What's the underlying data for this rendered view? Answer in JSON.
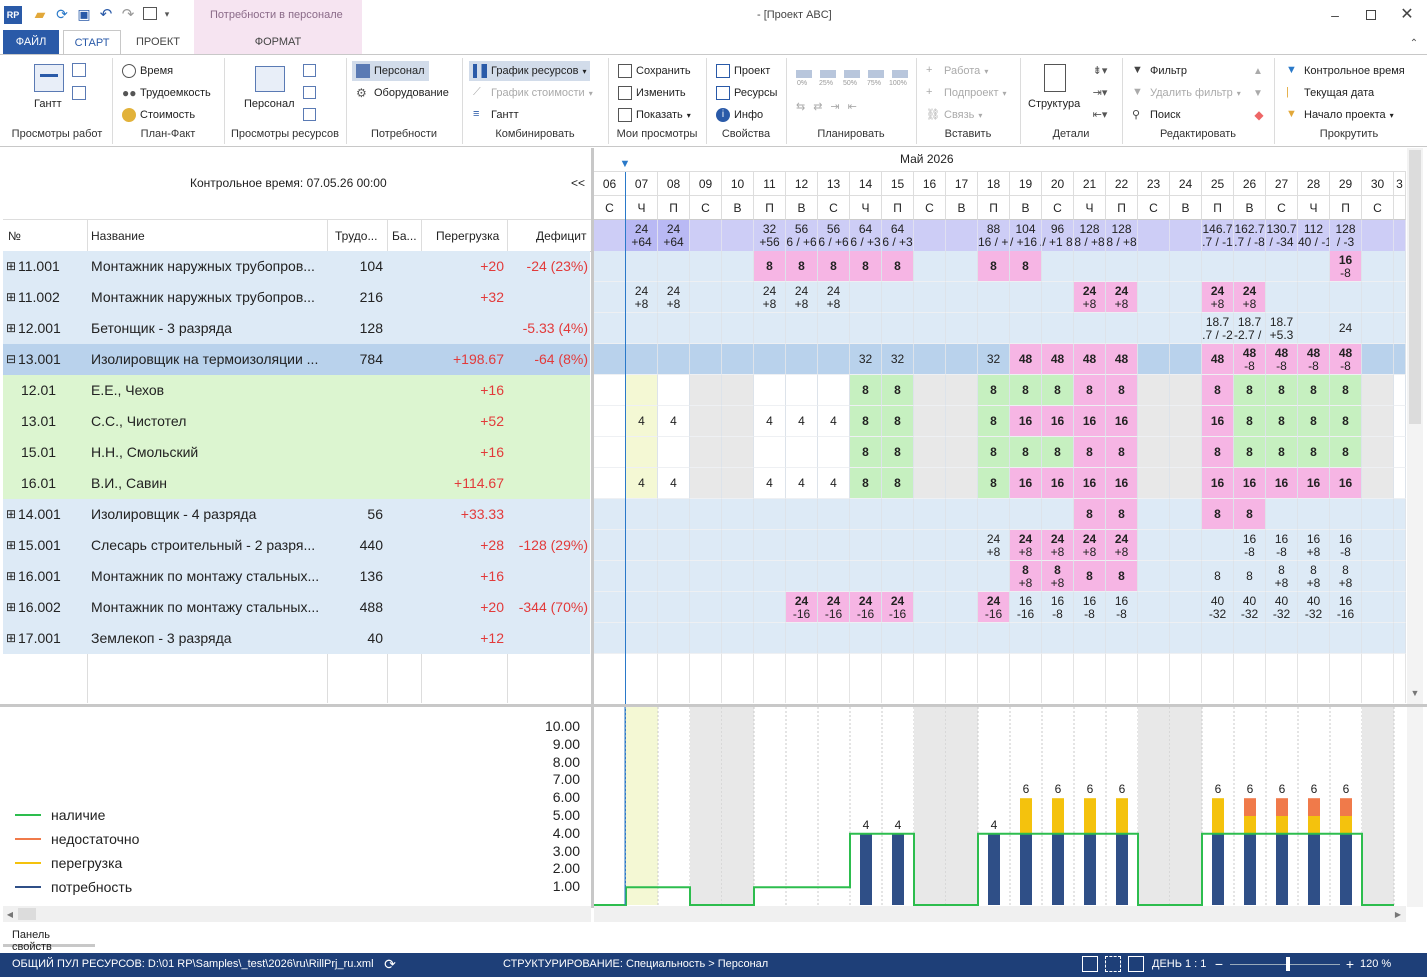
{
  "window": {
    "title": "- [Проект ABC]",
    "context_tab": "Потребности в персонале"
  },
  "menu": {
    "file": "ФАЙЛ",
    "tabs": [
      "СТАРТ",
      "ПРОЕКТ",
      "ФОРМАТ"
    ]
  },
  "ribbon": {
    "groups": [
      "Просмотры работ",
      "План-Факт",
      "Просмотры ресурсов",
      "Потребности",
      "Комбинировать",
      "Мои просмотры",
      "Свойства",
      "Планировать",
      "Вставить",
      "Детали",
      "Редактировать",
      "Прокрутить"
    ],
    "gantt": "Гантт",
    "plan_fact": [
      "Время",
      "Трудоемкость",
      "Стоимость"
    ],
    "personnel_view": "Персонал",
    "needs": [
      "Персонал",
      "Оборудование"
    ],
    "combine": [
      "График ресурсов",
      "График стоимости",
      "Гантт"
    ],
    "my_views": [
      "Сохранить",
      "Изменить",
      "Показать"
    ],
    "properties": [
      "Проект",
      "Ресурсы",
      "Инфо"
    ],
    "plan_pct": [
      "0%",
      "25%",
      "50%",
      "75%",
      "100%"
    ],
    "insert": [
      "Работа",
      "Подпроект",
      "Связь"
    ],
    "details": "Структура",
    "edit": [
      "Фильтр",
      "Удалить фильтр",
      "Поиск"
    ],
    "scroll": [
      "Контрольное время",
      "Текущая дата",
      "Начало проекта"
    ]
  },
  "left": {
    "control_time": "Контрольное время: 07.05.26 00:00",
    "collapse": "<<",
    "headers": [
      "№",
      "Название",
      "Трудо...",
      "Ба...",
      "Перегрузка",
      "Дефицит"
    ],
    "rows": [
      {
        "exp": "⊞",
        "num": "11.001",
        "name": "Монтажник наружных трубопров...",
        "work": "104",
        "over": "+20",
        "def": "-24 (23%)",
        "kind": "group"
      },
      {
        "exp": "⊞",
        "num": "11.002",
        "name": "Монтажник наружных трубопров...",
        "work": "216",
        "over": "+32",
        "def": "",
        "kind": "group"
      },
      {
        "exp": "⊞",
        "num": "12.001",
        "name": "Бетонщик - 3 разряда",
        "work": "128",
        "over": "",
        "def": "-5.33 (4%)",
        "kind": "group"
      },
      {
        "exp": "⊟",
        "num": "13.001",
        "name": "Изолировщик на термоизоляции ...",
        "work": "784",
        "over": "+198.67",
        "def": "-64 (8%)",
        "kind": "selected"
      },
      {
        "exp": "",
        "num": "12.01",
        "name": "Е.Е., Чехов",
        "work": "",
        "over": "+16",
        "def": "",
        "kind": "person"
      },
      {
        "exp": "",
        "num": "13.01",
        "name": "С.С., Чистотел",
        "work": "",
        "over": "+52",
        "def": "",
        "kind": "person"
      },
      {
        "exp": "",
        "num": "15.01",
        "name": "Н.Н., Смольский",
        "work": "",
        "over": "+16",
        "def": "",
        "kind": "person"
      },
      {
        "exp": "",
        "num": "16.01",
        "name": "В.И., Савин",
        "work": "",
        "over": "+114.67",
        "def": "",
        "kind": "person"
      },
      {
        "exp": "⊞",
        "num": "14.001",
        "name": "Изолировщик - 4 разряда",
        "work": "56",
        "over": "+33.33",
        "def": "",
        "kind": "group"
      },
      {
        "exp": "⊞",
        "num": "15.001",
        "name": "Слесарь строительный - 2 разря...",
        "work": "440",
        "over": "+28",
        "def": "-128 (29%)",
        "kind": "group"
      },
      {
        "exp": "⊞",
        "num": "16.001",
        "name": "Монтажник по монтажу стальных...",
        "work": "136",
        "over": "+16",
        "def": "",
        "kind": "group"
      },
      {
        "exp": "⊞",
        "num": "16.002",
        "name": "Монтажник по монтажу стальных...",
        "work": "488",
        "over": "+20",
        "def": "-344 (70%)",
        "kind": "group"
      },
      {
        "exp": "⊞",
        "num": "17.001",
        "name": "Землекоп - 3 разряда",
        "work": "40",
        "over": "+12",
        "def": "",
        "kind": "group"
      }
    ]
  },
  "timeline": {
    "month": "Май 2026",
    "days": [
      "06",
      "07",
      "08",
      "09",
      "10",
      "11",
      "12",
      "13",
      "14",
      "15",
      "16",
      "17",
      "18",
      "19",
      "20",
      "21",
      "22",
      "23",
      "24",
      "25",
      "26",
      "27",
      "28",
      "29",
      "30",
      "3"
    ],
    "weekdays": [
      "С",
      "Ч",
      "П",
      "С",
      "В",
      "П",
      "В",
      "С",
      "Ч",
      "П",
      "С",
      "В",
      "П",
      "В",
      "С",
      "Ч",
      "П",
      "С",
      "В",
      "П",
      "В",
      "С",
      "Ч",
      "П",
      "С",
      ""
    ],
    "weekend_cols": [
      3,
      4,
      10,
      11,
      17,
      18,
      24
    ],
    "summary": [
      "",
      "24|+64",
      "24|+64",
      "",
      "",
      "32|+56",
      "56|6 / +6",
      "56|6 / +6",
      "64|6 / +3",
      "64|6 / +3",
      "",
      "",
      "88|16 / +16",
      "104|/ +16 / +",
      "96|/ +1 8",
      "128|8 / +8",
      "128|8 / +8",
      "",
      "",
      "146.7|.7 / -1",
      "162.7|.7 / -8",
      "130.7|/ -34",
      "112|40 / -1",
      "128|/ -3",
      "",
      ""
    ],
    "grid": [
      [
        "",
        "|+4",
        "|+4",
        "",
        "",
        "8",
        "*8",
        "*8",
        "*8",
        "*8",
        "",
        "",
        "*8",
        "8",
        "",
        "",
        "",
        "",
        "",
        "",
        "",
        "",
        "",
        "*16|-8",
        "",
        ""
      ],
      [
        "",
        "24|+8",
        "24|+8",
        "",
        "",
        "24|+8",
        "24|+8",
        "24|+8",
        "|+8",
        "|+8",
        "",
        "",
        "|+8",
        "|+4",
        "|+4",
        "*24|+8",
        "*24|+8",
        "",
        "",
        "*24|+8",
        "*24|+8",
        "",
        "|+4",
        "",
        "",
        ""
      ],
      [
        "",
        "|+8",
        "|+8",
        "",
        "",
        "|+8",
        "|+8",
        "|+8",
        "|+12",
        "|+12",
        "",
        "",
        "|+4",
        "|+4",
        "|+4",
        "",
        "",
        "",
        "",
        "18.7|.7 / -2",
        "18.7|-2.7 / -2",
        "18.7|+5.3",
        "|+4",
        "24",
        "",
        ""
      ],
      [
        "",
        "|+8",
        "|+8",
        "",
        "",
        "|+8",
        "|+8",
        "|+8",
        "32",
        "32",
        "",
        "",
        "32",
        "*48",
        "*48",
        "*48",
        "*48",
        "",
        "",
        "*48",
        "*48|-8",
        "*48|-8",
        "*48|-8",
        "*48|-8",
        "",
        ""
      ],
      [
        "",
        "",
        "",
        "",
        "",
        "",
        "",
        "",
        "g8",
        "g8",
        "",
        "",
        "g8",
        "g8",
        "g8",
        "p8",
        "p8",
        "",
        "",
        "p8",
        "g8",
        "g8",
        "g8",
        "g8",
        "",
        ""
      ],
      [
        "",
        "4",
        "4",
        "",
        "",
        "4",
        "4",
        "4",
        "g8",
        "g8",
        "",
        "",
        "g8",
        "p16",
        "p16",
        "p16",
        "p16",
        "",
        "",
        "p16",
        "g8",
        "g8",
        "g8",
        "g8",
        "",
        ""
      ],
      [
        "",
        "",
        "",
        "",
        "",
        "",
        "",
        "",
        "g8",
        "g8",
        "",
        "",
        "g8",
        "g8",
        "g8",
        "p8",
        "p8",
        "",
        "",
        "p8",
        "g8",
        "g8",
        "g8",
        "g8",
        "",
        ""
      ],
      [
        "",
        "4",
        "4",
        "",
        "",
        "4",
        "4",
        "4",
        "g8",
        "g8",
        "",
        "",
        "g8",
        "p16",
        "p16",
        "p16",
        "p16",
        "",
        "",
        "p16",
        "p16",
        "p16",
        "p16",
        "p16",
        "",
        ""
      ],
      [
        "",
        "|+8",
        "|+8",
        "",
        "",
        "|+8",
        "|+8",
        "|+8",
        "",
        "",
        "",
        "",
        "",
        "",
        "",
        "*8",
        "*8",
        "",
        "",
        "*8",
        "*8",
        "",
        "",
        "",
        "",
        ""
      ],
      [
        "",
        "|+16",
        "|+16",
        "",
        "",
        "|+16",
        "|+16",
        "|+16",
        "|+16",
        "|+16",
        "",
        "",
        "24|+8",
        "*24|+8",
        "*24|+8",
        "*24|+8",
        "*24|+8",
        "",
        "",
        "|+4",
        "16|-8",
        "16|-8",
        "16|+8",
        "16|-8",
        "",
        ""
      ],
      [
        "",
        "|+4",
        "|+4",
        "",
        "",
        "|+4",
        "|+4",
        "|+4",
        "|+8",
        "|+8",
        "",
        "",
        "|+4",
        "*8|+8",
        "*8|+8",
        "*8",
        "*8",
        "",
        "",
        "8",
        "8",
        "8|+8",
        "8|+8",
        "8|+8",
        "",
        ""
      ],
      [
        "",
        "|+4",
        "|+4",
        "",
        "",
        "",
        "*24|-16",
        "*24|-16",
        "*24|-16",
        "*24|-16",
        "",
        "",
        "*24|-16",
        "16|-16",
        "16|-8",
        "16|-8",
        "16|-8",
        "",
        "",
        "40|-32",
        "40|-32",
        "40|-32",
        "40|-32",
        "16|-16",
        "",
        ""
      ],
      [
        "",
        "|+4",
        "|+4",
        "",
        "",
        "|+4",
        "|+4",
        "|+4",
        "|+4",
        "|+4",
        "",
        "",
        "",
        "",
        "",
        "",
        "",
        "",
        "",
        "|+4",
        "",
        "",
        "",
        "",
        "",
        ""
      ]
    ]
  },
  "histogram": {
    "yticks": [
      "10.00",
      "9.00",
      "8.00",
      "7.00",
      "6.00",
      "5.00",
      "4.00",
      "3.00",
      "2.00",
      "1.00"
    ],
    "legend": [
      {
        "label": "наличие",
        "color": "#2dbd4e"
      },
      {
        "label": "недостаточно",
        "color": "#f07a4a"
      },
      {
        "label": "перегрузка",
        "color": "#f4c20d"
      },
      {
        "label": "потребность",
        "color": "#2f4f87"
      }
    ],
    "chart_data": {
      "type": "bar",
      "categories": [
        "06",
        "07",
        "08",
        "09",
        "10",
        "11",
        "12",
        "13",
        "14",
        "15",
        "16",
        "17",
        "18",
        "19",
        "20",
        "21",
        "22",
        "23",
        "24",
        "25",
        "26",
        "27",
        "28",
        "29",
        "30"
      ],
      "series": [
        {
          "name": "потребность",
          "values": [
            0,
            0,
            0,
            0,
            0,
            0,
            0,
            0,
            4,
            4,
            0,
            0,
            4,
            4,
            4,
            4,
            4,
            0,
            0,
            4,
            4,
            4,
            4,
            4,
            0
          ]
        },
        {
          "name": "перегрузка",
          "values": [
            0,
            0,
            0,
            0,
            0,
            0,
            0,
            0,
            0,
            0,
            0,
            0,
            0,
            2,
            2,
            2,
            2,
            0,
            0,
            2,
            1,
            1,
            1,
            1,
            0
          ]
        },
        {
          "name": "недостаточно",
          "values": [
            0,
            0,
            0,
            0,
            0,
            0,
            0,
            0,
            0,
            0,
            0,
            0,
            0,
            0,
            0,
            0,
            0,
            0,
            0,
            0,
            1,
            1,
            1,
            1,
            0
          ]
        },
        {
          "name": "наличие",
          "values": [
            0,
            1,
            1,
            0,
            0,
            1,
            1,
            1,
            4,
            4,
            0,
            0,
            4,
            4,
            4,
            4,
            4,
            0,
            0,
            4,
            4,
            4,
            4,
            4,
            0
          ]
        }
      ],
      "bar_labels": [
        "",
        "",
        "",
        "",
        "",
        "",
        "",
        "",
        "4",
        "4",
        "",
        "",
        "4",
        "6",
        "6",
        "6",
        "6",
        "",
        "",
        "6",
        "6",
        "6",
        "6",
        "6",
        ""
      ],
      "ylim": [
        0,
        10.5
      ]
    }
  },
  "props_panel": "Панель свойств",
  "status": {
    "pool": "ОБЩИЙ ПУЛ РЕСУРСОВ: D:\\01 RP\\Samples\\_test\\2026\\ru\\RillPrj_ru.xml",
    "structure": "СТРУКТУРИРОВАНИЕ: Специальность > Персонал",
    "scale": "ДЕНЬ 1 : 1",
    "zoom": "120 %"
  }
}
